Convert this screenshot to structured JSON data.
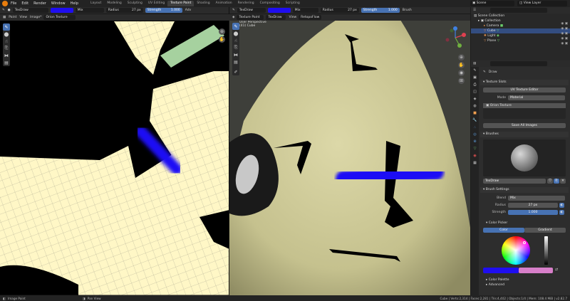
{
  "menu": [
    "File",
    "Edit",
    "Render",
    "Window",
    "Help"
  ],
  "workspaces": [
    "Layout",
    "Modeling",
    "Sculpting",
    "UV Editing",
    "Texture Paint",
    "Shading",
    "Animation",
    "Rendering",
    "Compositing",
    "Scripting"
  ],
  "active_workspace": "Texture Paint",
  "scene": "Scene",
  "view_layer": "View Layer",
  "uv_header": {
    "brush": "TexDraw",
    "blend": "Mix",
    "radius_label": "Radius",
    "radius_value": "27 px",
    "strength_label": "Strength",
    "strength_value": "1.000",
    "adv": "Adv",
    "mode": "Paint",
    "view": "View",
    "image": "Image*",
    "texture": "Orion Texture"
  },
  "vp_header": {
    "mode": "Texture Paint",
    "brush": "TexDraw",
    "view": "View",
    "retopoflow": "RetopoFlow",
    "blend": "Mix",
    "radius_label": "Radius",
    "radius_value": "27 px",
    "strength_label": "Strength",
    "strength_value": "1.000",
    "brush_menu": "Brush",
    "perspective": "User Perspective",
    "object_info": "(41) Cube"
  },
  "outliner": {
    "root": "Scene Collection",
    "collection": "Collection",
    "items": [
      "Camera",
      "Cube",
      "Light",
      "Plane"
    ],
    "selected": "Cube"
  },
  "props": {
    "tool": "Draw",
    "texture_slots": "Texture Slots",
    "uv_texture_editor": "UV Texture Editor",
    "mode_label": "Mode",
    "mode_value": "Material",
    "slot_name": "Orion Texture",
    "save_all": "Save All Images",
    "brushes": "Brushes",
    "brush_name": "TexDraw",
    "brush_settings": "Brush Settings",
    "blend_label": "Blend",
    "blend_value": "Mix",
    "radius_label": "Radius",
    "radius_value": "27 px",
    "strength_label": "Strength",
    "strength_value": "1.000",
    "color_picker": "Color Picker",
    "color_tab": "Color",
    "gradient_tab": "Gradient",
    "color_palette": "Color Palette",
    "advanced": "Advanced"
  },
  "status": {
    "left": "Image Paint",
    "middle": "Pan View",
    "right": "Cube | Verts:2,314 | Faces:2,281 | Tris:4,402 | Objects:1/4 | Mem: 108.4 MiB | v2.82.7"
  },
  "colors": {
    "accent": "#4772b3",
    "brush_color": "#1f0ef0",
    "secondary_color": "#d77fc9",
    "uv_face": "#fff7c6",
    "model_surface": "#c9c592"
  }
}
